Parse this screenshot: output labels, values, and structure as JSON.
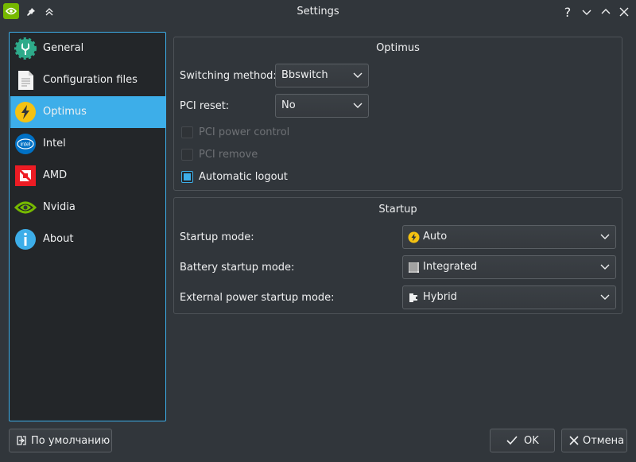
{
  "window": {
    "title": "Settings"
  },
  "sidebar": {
    "items": [
      {
        "label": "General",
        "icon": "wrench-gear-icon"
      },
      {
        "label": "Configuration files",
        "icon": "document-icon"
      },
      {
        "label": "Optimus",
        "icon": "lightning-icon",
        "selected": true
      },
      {
        "label": "Intel",
        "icon": "intel-logo-icon"
      },
      {
        "label": "AMD",
        "icon": "amd-logo-icon"
      },
      {
        "label": "Nvidia",
        "icon": "nvidia-logo-icon"
      },
      {
        "label": "About",
        "icon": "info-icon"
      }
    ]
  },
  "optimus": {
    "title": "Optimus",
    "switching_method": {
      "label": "Switching method:",
      "value": "Bbswitch"
    },
    "pci_reset": {
      "label": "PCI reset:",
      "value": "No"
    },
    "pci_power_control": {
      "label": "PCI power control",
      "checked": false,
      "enabled": false
    },
    "pci_remove": {
      "label": "PCI remove",
      "checked": false,
      "enabled": false
    },
    "automatic_logout": {
      "label": "Automatic logout",
      "checked": true,
      "enabled": true
    }
  },
  "startup": {
    "title": "Startup",
    "startup_mode": {
      "label": "Startup mode:",
      "value": "Auto",
      "icon": "lightning-icon"
    },
    "battery_startup_mode": {
      "label": "Battery startup mode:",
      "value": "Integrated",
      "icon": "chip-icon"
    },
    "external_power_startup_mode": {
      "label": "External power startup mode:",
      "value": "Hybrid",
      "icon": "hybrid-icon"
    }
  },
  "footer": {
    "defaults_label": "По умолчанию",
    "ok_label": "OK",
    "cancel_label": "Отмена"
  },
  "colors": {
    "accent": "#3daee9",
    "nvidia": "#76b900",
    "amd": "#ed1c24",
    "intel": "#0071c5"
  }
}
